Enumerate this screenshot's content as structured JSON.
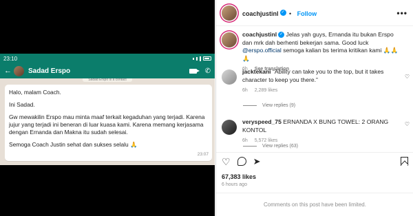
{
  "phone": {
    "status_time": "23:10",
    "contact_name": "Sadad Erspo",
    "system_note": "Sadad Erspo is a contact",
    "message": {
      "lines": [
        "Halo, malam Coach.",
        "Ini Sadad.",
        "Gw mewakilin Erspo mau minta maaf terkait kegaduhan yang terjadi. Karena jujur yang terjadi ini beneran di luar kuasa kami. Karena memang kerjasama dengan Ernanda dan Makna itu sudah selesai.",
        "Semoga Coach Justin sehat dan sukses selalu 🙏"
      ],
      "time": "23:07"
    }
  },
  "post": {
    "username": "coachjustinl",
    "follow_label": "Follow",
    "more_label": "•••",
    "caption": {
      "user": "coachjustinl",
      "text_before": "Jelas yah guys, Ernanda itu bukan Erspo dan mrk dah berhenti bekerjan sama. Good luck ",
      "mention": "@erspo.official",
      "text_after": " semoga kalian bs terima kritikan kami 🙏🙏🙏",
      "age": "6h",
      "see_translation": "See translation"
    },
    "comments": [
      {
        "user": "jacktekani",
        "text": "“Ability can take you to the top, but it takes character to keep you there.”",
        "age": "6h",
        "likes": "2,289 likes",
        "replies": "View replies (9)"
      },
      {
        "user": "veryspeed_75",
        "text": "ERNANDA X BUNG TOWEL: 2 ORANG KONTOL",
        "age": "6h",
        "likes": "5,572 likes",
        "replies": "View replies (63)"
      }
    ],
    "likes_count": "67,383 likes",
    "time_ago": "6 hours ago",
    "comments_limited": "Comments on this post have been limited."
  },
  "icons": {
    "heart": "heart-icon",
    "comment": "comment-icon",
    "share": "share-icon",
    "bookmark": "bookmark-icon",
    "verified": "verified-badge-icon"
  },
  "colors": {
    "whatsapp_green": "#0b7d6b",
    "follow_blue": "#0095f6",
    "verified_blue": "#0095f6"
  }
}
